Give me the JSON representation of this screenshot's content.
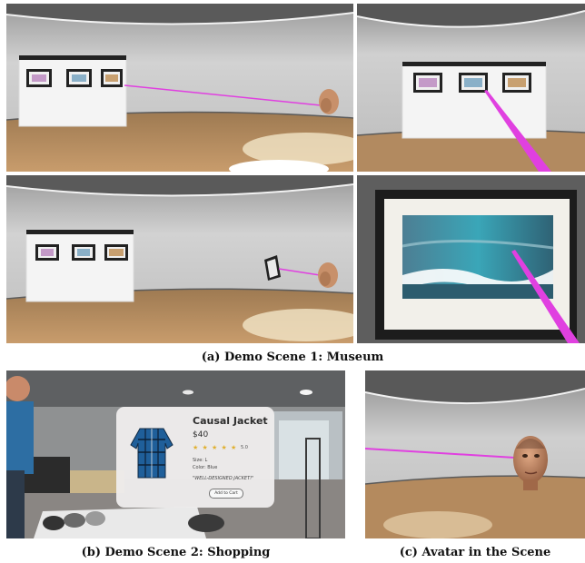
{
  "product_card": {
    "title": "Causal Jacket",
    "price": "$40",
    "stars": "★ ★ ★ ★ ★",
    "rating": "5.0",
    "size": "Size: L",
    "color": "Color: Blue",
    "quote": "\"WELL-DESIGNED JACKET!\"",
    "cart_button": "Add to Cart"
  },
  "captions": {
    "museum": "(a) Demo Scene 1: Museum",
    "shopping": "(b) Demo Scene 2: Shopping",
    "avatar": "(c) Avatar in the Scene"
  },
  "colors": {
    "pointer_ray": "#e040e0",
    "floor": "#b48a5e",
    "wall": "#c9c9c9"
  }
}
